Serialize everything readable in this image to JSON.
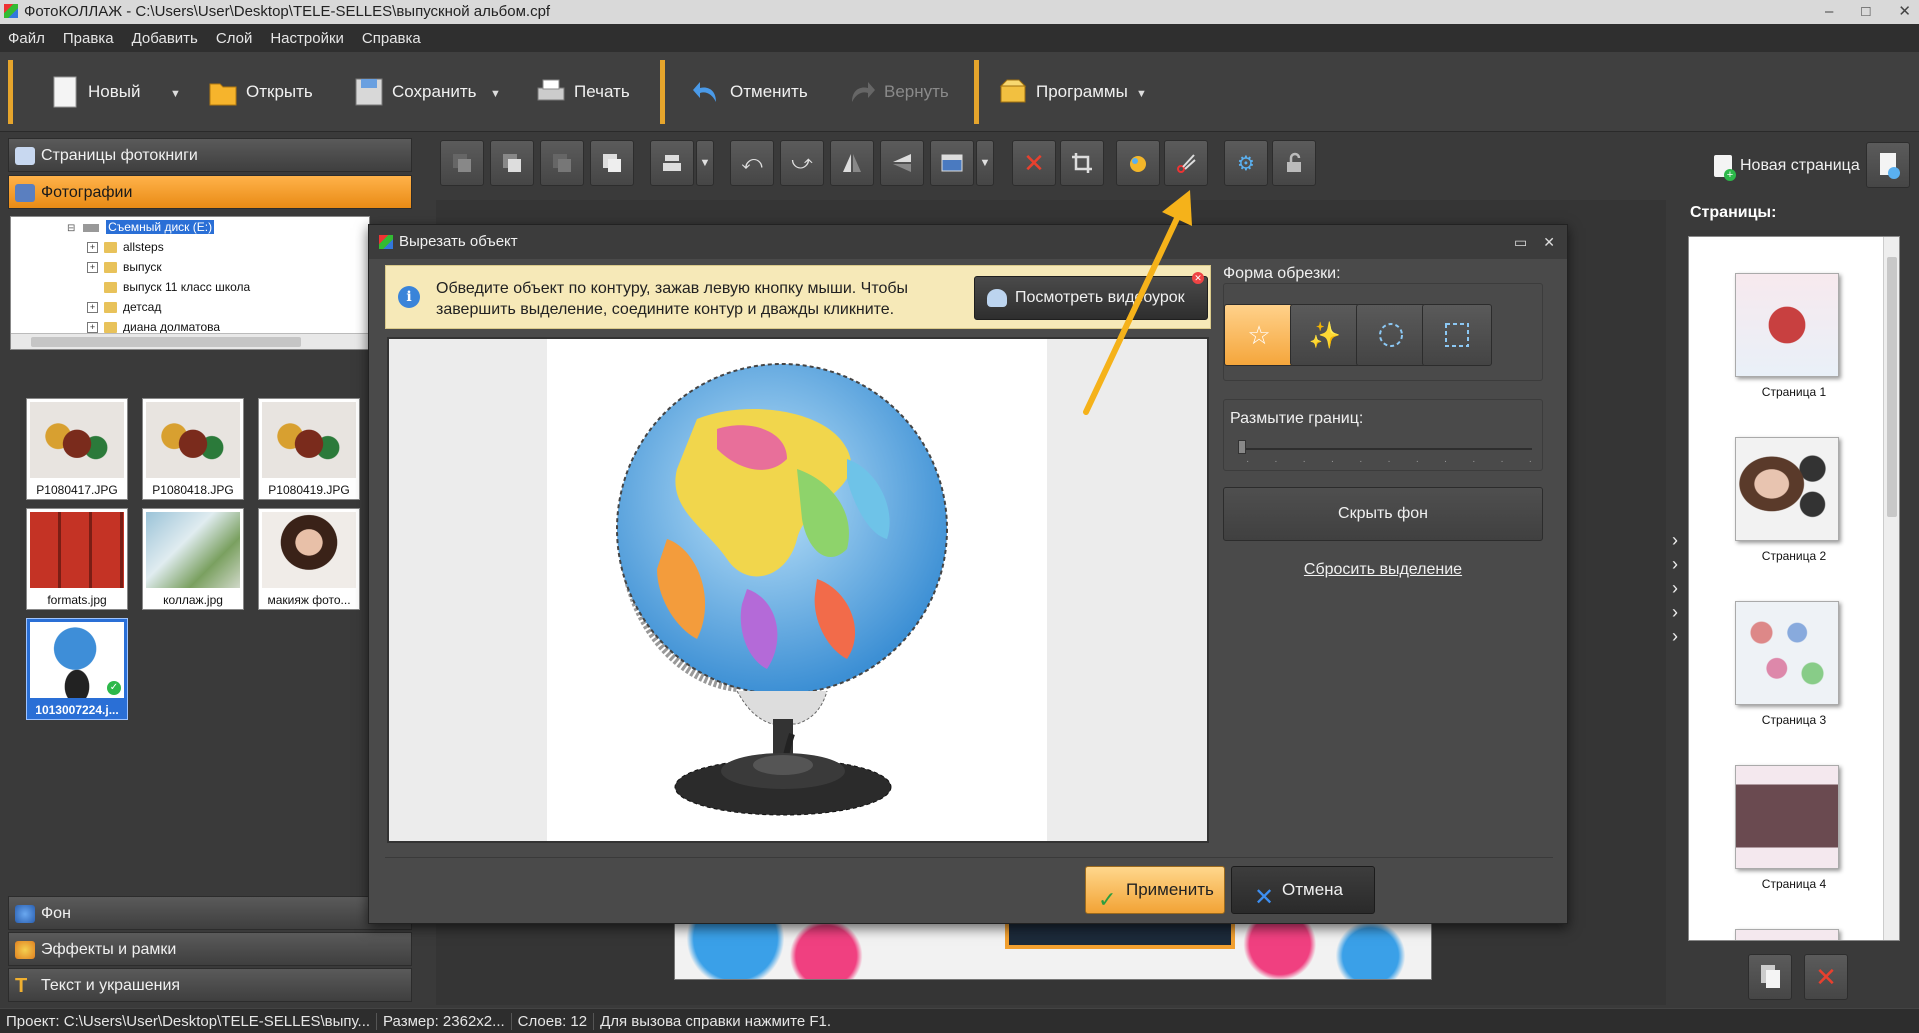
{
  "window": {
    "title": "ФотоКОЛЛАЖ - C:\\Users\\User\\Desktop\\TELE-SELLES\\выпускной альбом.cpf",
    "controls": [
      "–",
      "□",
      "✕"
    ]
  },
  "menu": [
    "Файл",
    "Правка",
    "Добавить",
    "Слой",
    "Настройки",
    "Справка"
  ],
  "toolbar": {
    "new": "Новый",
    "open": "Открыть",
    "save": "Сохранить",
    "print": "Печать",
    "undo": "Отменить",
    "redo": "Вернуть",
    "programs": "Программы"
  },
  "left": {
    "book_pages": "Страницы фотокниги",
    "photos": "Фотографии",
    "background": "Фон",
    "effects": "Эффекты и рамки",
    "text": "Текст и украшения",
    "tree": [
      "Съемный диск (E:)",
      "allsteps",
      "выпуск",
      "выпуск 11 класс школа",
      "детсад",
      "диана долматова"
    ],
    "thumbs": [
      "P1080417.JPG",
      "P1080418.JPG",
      "P1080419.JPG",
      "formats.jpg",
      "коллаж.jpg",
      "макияж фото...",
      "1013007224.j..."
    ]
  },
  "new_page": "Новая страница",
  "pages": {
    "title": "Страницы:",
    "items": [
      "Страница 1",
      "Страница 2",
      "Страница 3",
      "Страница 4"
    ]
  },
  "dialog": {
    "title": "Вырезать объект",
    "info": "Обведите объект по контуру, зажав левую кнопку мыши. Чтобы завершить выделение, соедините контур и дважды кликните.",
    "video_button": "Посмотреть видеоурок",
    "shape_label": "Форма обрезки:",
    "blur_label": "Размытие границ:",
    "hide_bg": "Скрыть фон",
    "reset": "Сбросить выделение",
    "apply": "Применить",
    "cancel": "Отмена"
  },
  "status": {
    "project": "Проект:  C:\\Users\\User\\Desktop\\TELE-SELLES\\выпу...",
    "size": "Размер:  2362x2...",
    "layers": "Слоев:  12",
    "help": "Для вызова справки нажмите F1."
  },
  "colors": {
    "accent": "#f0a030",
    "arrow": "#f5b21a",
    "bg": "#3a3a3a"
  }
}
